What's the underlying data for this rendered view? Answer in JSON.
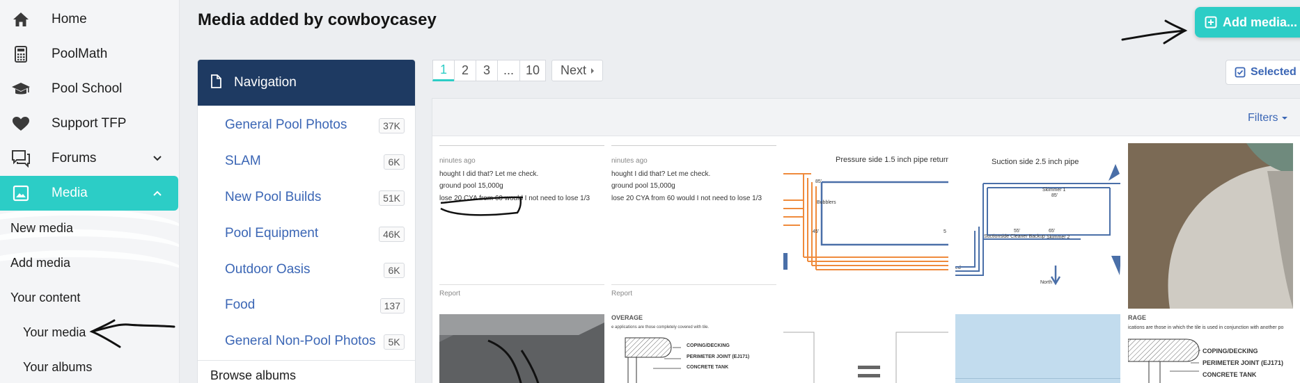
{
  "sidebar": {
    "items": [
      {
        "label": "Home",
        "icon": "home-icon"
      },
      {
        "label": "PoolMath",
        "icon": "calculator-icon"
      },
      {
        "label": "Pool School",
        "icon": "graduation-cap-icon"
      },
      {
        "label": "Support TFP",
        "icon": "heart-icon"
      },
      {
        "label": "Forums",
        "icon": "comments-icon"
      },
      {
        "label": "Media",
        "icon": "image-icon"
      }
    ],
    "sub_items": [
      "New media",
      "Add media",
      "Your content"
    ],
    "nested_items": [
      "Your media",
      "Your albums"
    ]
  },
  "page": {
    "title": "Media added by cowboycasey",
    "add_media_label": "Add media...",
    "selected_label": "Selected"
  },
  "navigation": {
    "header": "Navigation",
    "categories": [
      {
        "label": "General Pool Photos",
        "count": "37K"
      },
      {
        "label": "SLAM",
        "count": "6K"
      },
      {
        "label": "New Pool Builds",
        "count": "51K"
      },
      {
        "label": "Pool Equipment",
        "count": "46K"
      },
      {
        "label": "Outdoor Oasis",
        "count": "6K"
      },
      {
        "label": "Food",
        "count": "137"
      },
      {
        "label": "General Non-Pool Photos",
        "count": "5K"
      }
    ],
    "browse_albums": "Browse albums"
  },
  "pagination": {
    "pages": [
      "1",
      "2",
      "3",
      "...",
      "10"
    ],
    "current": "1",
    "next_label": "Next"
  },
  "media": {
    "filters_label": "Filters",
    "thumb1": {
      "time": "ninutes ago",
      "line1": "hought I did that? Let me check.",
      "line2": "ground pool 15,000g",
      "line3": "lose 20 CYA from 60 would I not need to lose 1/3"
    },
    "thumb2": {
      "time": "ninutes ago",
      "line1": "hought I did that? Let me check.",
      "line2": "ground pool 15,000g",
      "line3": "lose 20 CYA from 60 would I not need to lose 1/3"
    },
    "thumb3": {
      "title": "Pressure side 1.5 inch pipe return",
      "label_85": "85'",
      "label_bubblers": "Bubblers",
      "label_45": "45'",
      "label_5": "5",
      "label_ed": "ed"
    },
    "thumb4": {
      "title": "Suction side 2.5 inch pipe",
      "skimmer1": "Skimmer 1",
      "label_85": "85'",
      "label_55": "55'",
      "label_65": "65'",
      "cleaner": "Suctionside Cleaner Backup",
      "skimmer2": "Skimmer 2",
      "north": "North"
    },
    "report1": "Report",
    "report2": "Report",
    "thumb7": {
      "heading": "OVERAGE",
      "caption": "e applications are those completely covered with tile.",
      "coping": "COPING/DECKING",
      "perimeter": "PERIMETER JOINT (EJ171)",
      "concrete": "CONCRETE TANK"
    },
    "thumb10": {
      "heading": "RAGE",
      "caption": "ications are those in which the tile is used in conjunction with another po",
      "coping": "COPING/DECKING",
      "perimeter": "PERIMETER JOINT (EJ171)",
      "concrete": "CONCRETE TANK"
    }
  },
  "colors": {
    "accent": "#2ccdc6",
    "nav_header": "#1e3a62",
    "link": "#3b66b5",
    "pipe_blue": "#4a6fa8",
    "pipe_orange": "#ef8a3b"
  }
}
